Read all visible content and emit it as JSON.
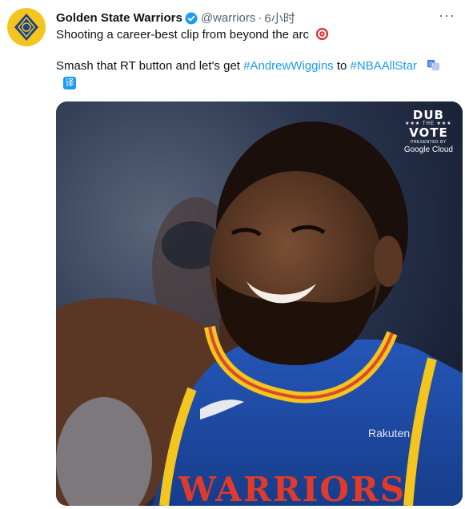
{
  "tweet": {
    "author_name": "Golden State Warriors",
    "handle": "@warriors",
    "separator": "·",
    "time": "6小时",
    "more_label": "···",
    "line1": "Shooting a career-best clip from beyond the arc",
    "line2_prefix": "Smash that RT button and let's get ",
    "hashtag1": "#AndrewWiggins",
    "line2_mid": " to ",
    "hashtag2": "#NBAAllStar",
    "translate_label": "译"
  },
  "media": {
    "badge_dub": "DUB",
    "badge_the": "★★★ THE ★★★",
    "badge_vote": "VOTE",
    "badge_presented": "PRESENTED BY",
    "badge_sponsor": "Google Cloud",
    "jersey_text": "WARRIORS",
    "sponsor_patch": "Rakuten"
  },
  "colors": {
    "link": "#1d9bf0",
    "verified": "#1d9bf0",
    "warriors_gold": "#f4c41f",
    "jersey_blue": "#1d4fa8"
  },
  "icons": {
    "verified": "verified-badge-icon",
    "target": "direct-hit-emoji-icon",
    "translate": "translate-icon",
    "more": "more-options-icon"
  }
}
